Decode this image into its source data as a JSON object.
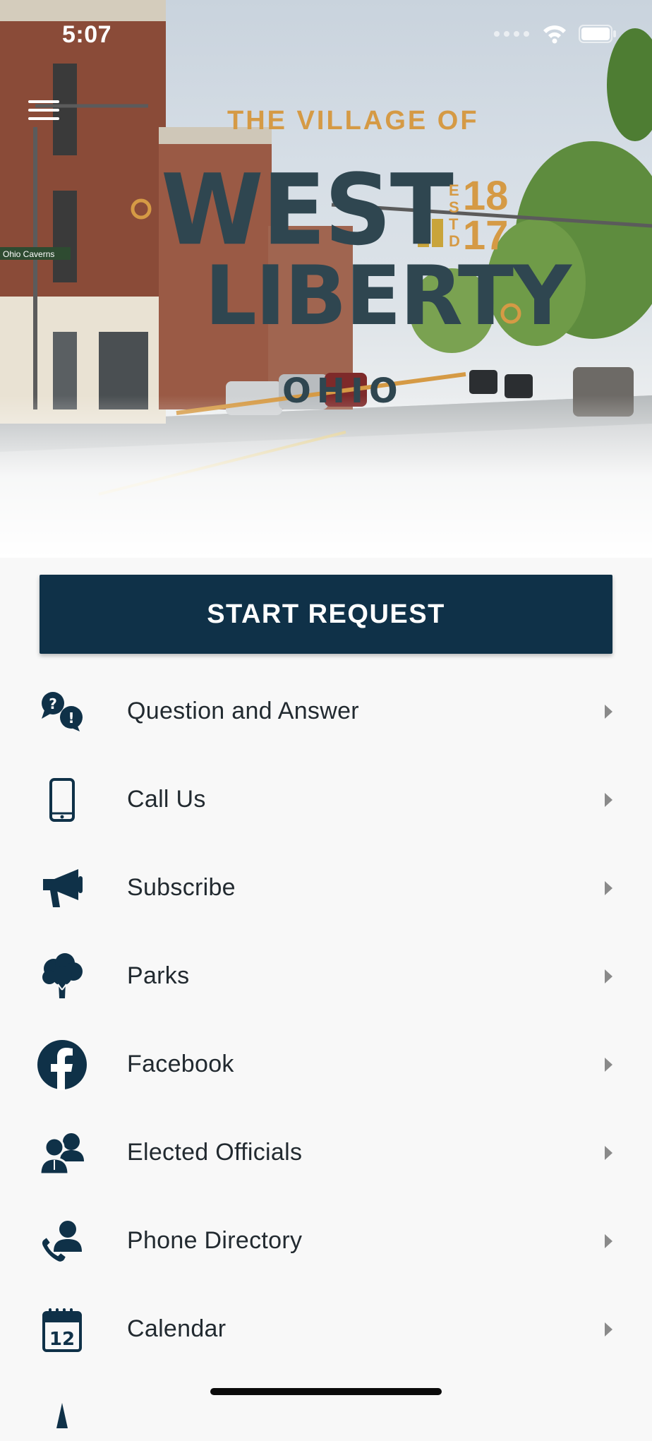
{
  "status_bar": {
    "time": "5:07"
  },
  "hero": {
    "logo_arc": "THE VILLAGE OF",
    "logo_line1": "WEST",
    "logo_line2": "LIBERTY",
    "logo_state": "OHIO",
    "estd_letters": [
      "E",
      "S",
      "T",
      "D"
    ],
    "estd_years": [
      "18",
      "17"
    ],
    "street_sign": "Ohio Caverns",
    "colors": {
      "logo_dark": "#2f4650",
      "logo_gold": "#d59a45"
    }
  },
  "start_button": {
    "label": "START REQUEST",
    "color": "#0f3148"
  },
  "menu": [
    {
      "label": "Question and Answer",
      "icon": "question-answer-icon"
    },
    {
      "label": "Call Us",
      "icon": "phone-icon"
    },
    {
      "label": "Subscribe",
      "icon": "megaphone-icon"
    },
    {
      "label": "Parks",
      "icon": "tree-icon"
    },
    {
      "label": "Facebook",
      "icon": "facebook-icon"
    },
    {
      "label": "Elected Officials",
      "icon": "officials-icon"
    },
    {
      "label": "Phone Directory",
      "icon": "phone-directory-icon"
    },
    {
      "label": "Calendar",
      "icon": "calendar-icon"
    }
  ],
  "calendar_icon_day": "12",
  "icon_color": "#0f3148"
}
